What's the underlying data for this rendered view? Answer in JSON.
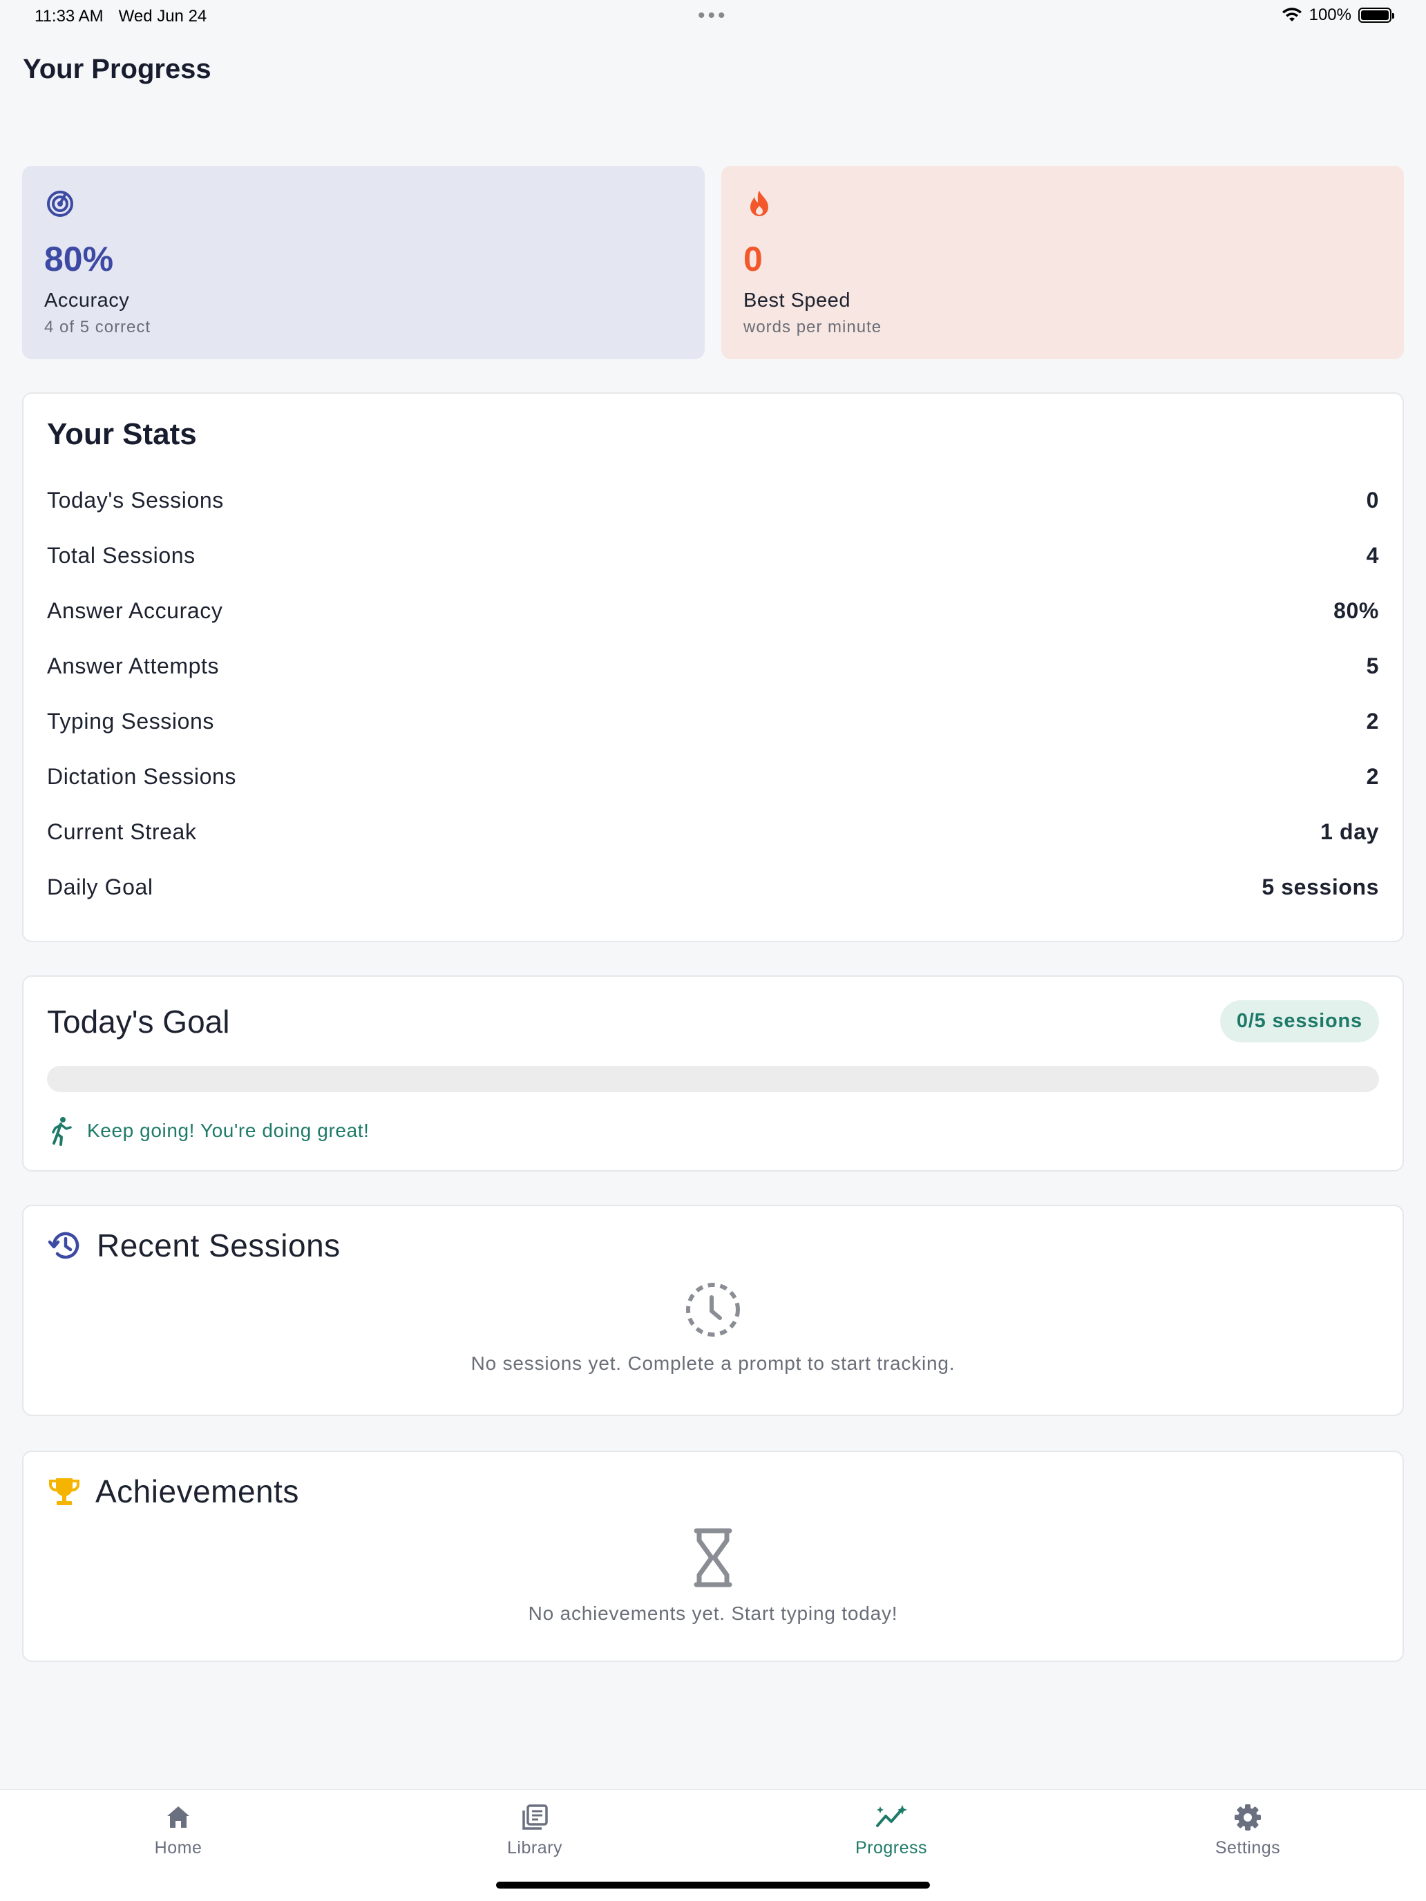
{
  "status_bar": {
    "time": "11:33 AM",
    "date": "Wed Jun 24",
    "battery": "100%"
  },
  "page": {
    "title": "Your Progress"
  },
  "metrics": {
    "accuracy": {
      "value": "80%",
      "label": "Accuracy",
      "sub": "4 of 5 correct",
      "icon": "target-icon",
      "color": "#3d4aa3"
    },
    "speed": {
      "value": "0",
      "label": "Best Speed",
      "sub": "words per minute",
      "icon": "flame-icon",
      "color": "#f2582c"
    }
  },
  "stats": {
    "title": "Your Stats",
    "rows": [
      {
        "label": "Today's Sessions",
        "value": "0"
      },
      {
        "label": "Total Sessions",
        "value": "4"
      },
      {
        "label": "Answer Accuracy",
        "value": "80%"
      },
      {
        "label": "Answer Attempts",
        "value": "5"
      },
      {
        "label": "Typing Sessions",
        "value": "2"
      },
      {
        "label": "Dictation Sessions",
        "value": "2"
      },
      {
        "label": "Current Streak",
        "value": "1 day"
      },
      {
        "label": "Daily Goal",
        "value": "5 sessions"
      }
    ]
  },
  "goal": {
    "title": "Today's Goal",
    "badge": "0/5 sessions",
    "progress": 0,
    "message": "Keep going! You're doing great!"
  },
  "recent": {
    "title": "Recent Sessions",
    "empty": "No sessions yet. Complete a prompt to start tracking."
  },
  "achievements": {
    "title": "Achievements",
    "empty": "No achievements yet. Start typing today!"
  },
  "tabs": [
    {
      "label": "Home",
      "icon": "home-icon"
    },
    {
      "label": "Library",
      "icon": "library-icon"
    },
    {
      "label": "Progress",
      "icon": "progress-icon",
      "active": true
    },
    {
      "label": "Settings",
      "icon": "gear-icon"
    }
  ],
  "colors": {
    "accent": "#1e7a68",
    "accuracy": "#3d4aa3",
    "speed": "#f2582c",
    "trophy": "#f5b400"
  }
}
